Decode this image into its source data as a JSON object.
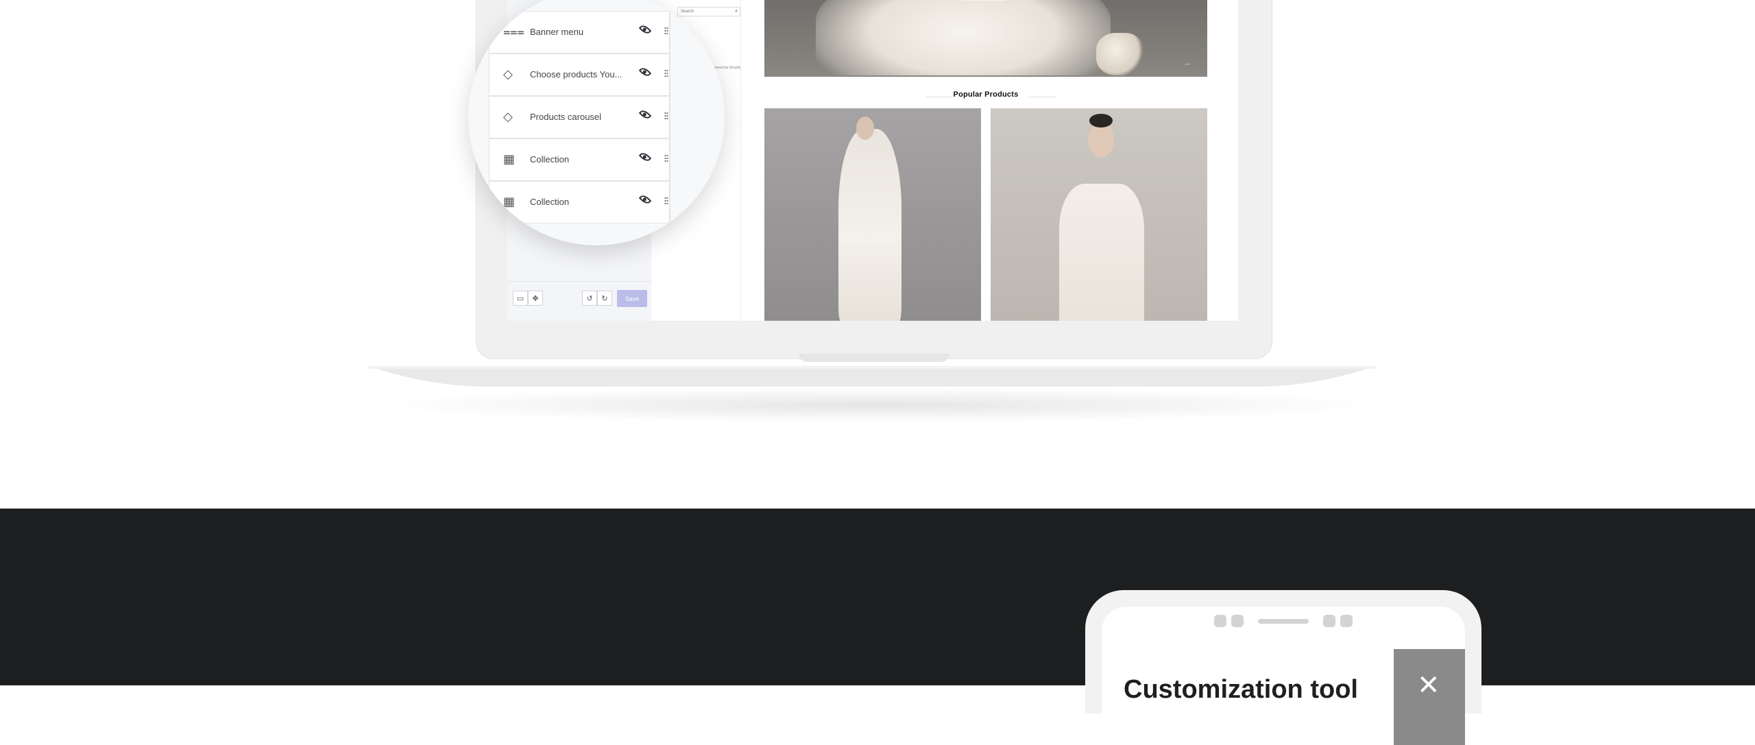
{
  "editor": {
    "save_label": "Save",
    "undo_icon": "undo-icon",
    "redo_icon": "redo-icon"
  },
  "storefront": {
    "search_placeholder": "Search",
    "powered_by": "Powered by Shopify",
    "section_title": "Popular Products"
  },
  "magnifier": {
    "rows": [
      {
        "label": "Banner menu",
        "icon": "banner-menu-icon"
      },
      {
        "label": "Choose products You...",
        "icon": "tag-icon"
      },
      {
        "label": "Products carousel",
        "icon": "tag-icon"
      },
      {
        "label": "Collection",
        "icon": "collection-icon"
      },
      {
        "label": "Collection",
        "icon": "collection-icon"
      }
    ]
  },
  "phone": {
    "title": "Customization tool"
  },
  "colors": {
    "dark_band": "#1d1e20",
    "save_button": "#b9bde8",
    "eye_icon": "#2e3036"
  }
}
